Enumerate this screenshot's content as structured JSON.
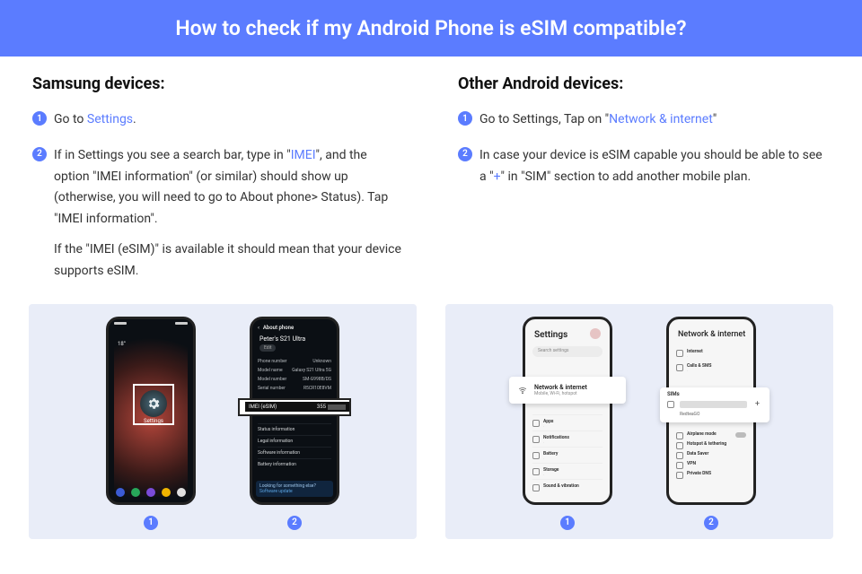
{
  "header": {
    "title": "How to check if my Android Phone is eSIM compatible?"
  },
  "left": {
    "heading": "Samsung devices:",
    "step1_a": "Go to ",
    "step1_link": "Settings",
    "step1_b": ".",
    "step2_a": "If in Settings you see a search bar, type in \"",
    "step2_link": "IMEI",
    "step2_b": "\", and the option \"IMEI information\" (or similar) should show up (otherwise, you will need to go to About phone> Status). Tap \"IMEI information\".",
    "step2_p2": "If the \"IMEI (eSIM)\" is available it should mean that your device supports eSIM.",
    "num1": "1",
    "num2": "2"
  },
  "right": {
    "heading": "Other Android devices:",
    "step1_a": "Go to Settings, Tap on \"",
    "step1_link": "Network & internet",
    "step1_b": "\"",
    "step2_a": "In case your device is eSIM capable you should be able to see a \"",
    "step2_link": "+",
    "step2_b": "\" in \"SIM\" section to add another mobile plan.",
    "num1": "1",
    "num2": "2"
  },
  "phones": {
    "labels": {
      "p1": "1",
      "p2": "2",
      "p3": "1",
      "p4": "2"
    },
    "p1": {
      "weather": "18°",
      "tile_label": "Settings"
    },
    "p2": {
      "title": "About phone",
      "device": "Peter's S21 Ultra",
      "edit": "Edit",
      "r1k": "Phone number",
      "r1v": "Unknown",
      "r2k": "Model name",
      "r2v": "Galaxy S21 Ultra 5G",
      "r3k": "Model number",
      "r3v": "SM-G998B/DS",
      "r4k": "Serial number",
      "r4v": "R5CR10E8VM",
      "imei_label": "IMEI (eSIM)",
      "imei_val": "355",
      "l1": "Status information",
      "l2": "Legal information",
      "l3": "Software information",
      "l4": "Battery information",
      "prompt_t": "Looking for something else?",
      "prompt_s": "Software update"
    },
    "p3": {
      "title": "Settings",
      "search": "Search settings",
      "call_t": "Network & internet",
      "call_s": "Mobile, Wi-Fi, hotspot",
      "l1": "Apps",
      "l2": "Notifications",
      "l3": "Battery",
      "l4": "Storage",
      "l5": "Sound & vibration"
    },
    "p4": {
      "title": "Network & internet",
      "a1": "Internet",
      "a2": "Calls & SMS",
      "sims": "SIMs",
      "sub": "RedteaGO",
      "plus": "+",
      "b1": "Airplane mode",
      "b2": "Hotspot & tethering",
      "b3": "Data Saver",
      "b4": "VPN",
      "b5": "Private DNS"
    }
  }
}
